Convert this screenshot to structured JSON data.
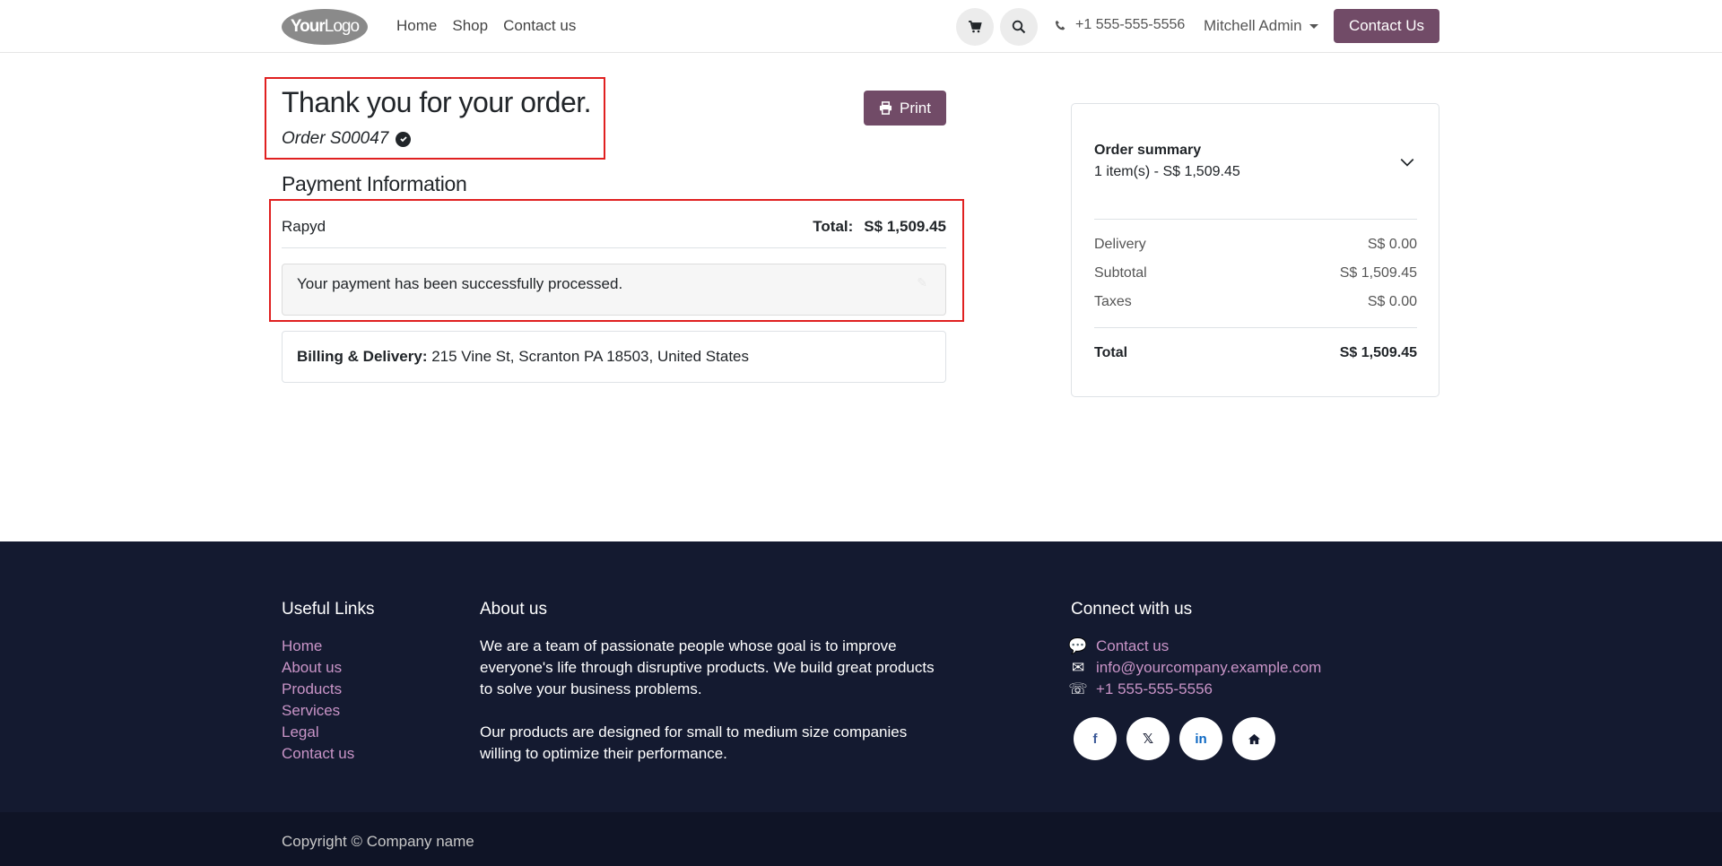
{
  "header": {
    "logo_bold": "Your",
    "logo_thin": "Logo",
    "nav": [
      "Home",
      "Shop",
      "Contact us"
    ],
    "phone": "+1 555-555-5556",
    "user": "Mitchell Admin",
    "contact_button": "Contact Us"
  },
  "confirmation": {
    "title": "Thank you for your order.",
    "order_ref": "Order S00047",
    "print_label": "Print"
  },
  "payment": {
    "heading": "Payment Information",
    "provider": "Rapyd",
    "total_label": "Total:",
    "total_value": "S$ 1,509.45",
    "message": "Your payment has been successfully processed."
  },
  "address": {
    "label": "Billing & Delivery:",
    "value": "215 Vine St, Scranton PA 18503, United States"
  },
  "summary": {
    "title": "Order summary",
    "items": "1 item(s) -  S$ 1,509.45",
    "rows": [
      {
        "label": "Delivery",
        "value": "S$ 0.00"
      },
      {
        "label": "Subtotal",
        "value": "S$ 1,509.45"
      },
      {
        "label": "Taxes",
        "value": "S$ 0.00"
      }
    ],
    "total_label": "Total",
    "total_value": "S$ 1,509.45"
  },
  "footer": {
    "useful_links_heading": "Useful Links",
    "useful_links": [
      "Home",
      "About us",
      "Products",
      "Services",
      "Legal",
      "Contact us"
    ],
    "about_heading": "About us",
    "about_p1": "We are a team of passionate people whose goal is to improve everyone's life through disruptive products. We build great products to solve your business problems.",
    "about_p2": "Our products are designed for small to medium size companies willing to optimize their performance.",
    "connect_heading": "Connect with us",
    "connect_contact": "Contact us",
    "connect_email": "info@yourcompany.example.com",
    "connect_phone": "+1 555-555-5556",
    "social_facebook": "f",
    "social_x": "𝕏",
    "social_linkedin": "in",
    "copyright": "Copyright © Company name"
  },
  "icons": [
    "cart-icon",
    "search-icon",
    "phone-icon",
    "check-circle-icon",
    "printer-icon",
    "chevron-down-icon",
    "comment-icon",
    "envelope-icon",
    "facebook-icon",
    "x-icon",
    "linkedin-icon",
    "home-icon"
  ],
  "colors": {
    "brand": "#714b67",
    "highlight": "#e02020",
    "footer_bg": "#141a30",
    "footer_link": "#c994c7"
  }
}
